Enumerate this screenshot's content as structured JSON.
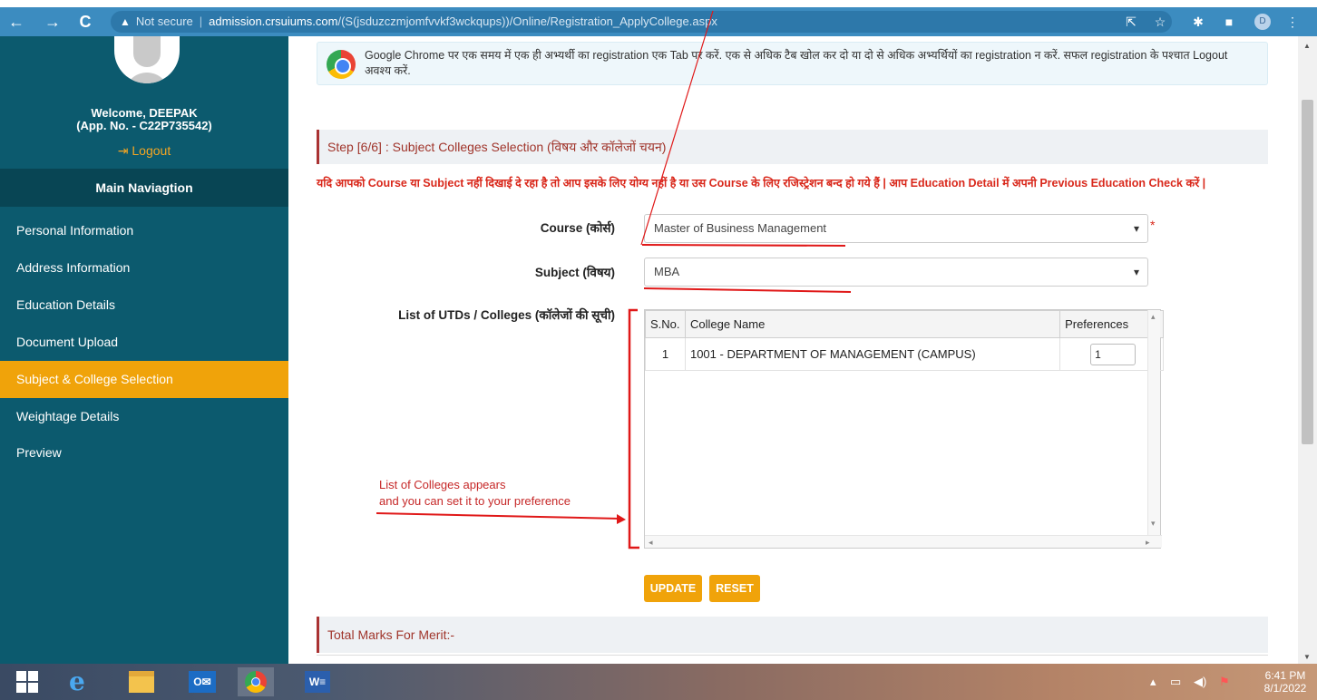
{
  "browser": {
    "nav": {
      "back": "←",
      "forward": "→",
      "reload": "C"
    },
    "url": {
      "warning_icon": "warning-icon",
      "security": "Not secure",
      "host": "admission.crsuiums.com",
      "path": "/(S(jsduzczmjomfvvkf3wckqups))/Online/Registration_ApplyCollege.aspx"
    },
    "profile_initial": "D",
    "icons": [
      "share-icon",
      "star-icon",
      "extensions-icon",
      "sidebar-icon",
      "profile-icon",
      "menu-icon"
    ]
  },
  "sidebar": {
    "welcome": "Welcome, DEEPAK",
    "app_no": "(App. No. - C22P735542)",
    "logout": "Logout",
    "nav_header": "Main Naviagtion",
    "items": [
      {
        "label": "Personal Information"
      },
      {
        "label": "Address Information"
      },
      {
        "label": "Education Details"
      },
      {
        "label": "Document Upload"
      },
      {
        "label": "Subject & College Selection",
        "active": true
      },
      {
        "label": "Weightage Details"
      },
      {
        "label": "Preview"
      }
    ]
  },
  "main": {
    "alert": "Google Chrome पर एक समय में एक ही अभ्यर्थी का registration एक Tab पर करें. एक से अधिक टैब खोल कर दो या दो से अधिक अभ्यर्थियों का registration न करें. सफल registration के पश्चात Logout अवश्य करें.",
    "step_prefix": "Step [6/6] :",
    "step_title": "Subject Colleges Selection (विषय और कॉलेजों चयन)",
    "warning": "यदि आपको Course या Subject नहीं दिखाई दे रहा है तो आप इसके लिए योग्य नहीं है या उस Course के लिए रजिस्ट्रेशन बन्द हो गये हैं | आप Education Detail में अपनी Previous Education Check करें |",
    "course_label": "Course (कोर्स)",
    "course_value": "Master of Business Management",
    "subject_label": "Subject (विषय)",
    "subject_value": "MBA",
    "colleges_label": "List of UTDs / Colleges (कॉलेजों की सूची)",
    "table": {
      "headers": [
        "S.No.",
        "College Name",
        "Preferences"
      ],
      "rows": [
        {
          "sno": "1",
          "name": "1001 - DEPARTMENT OF MANAGEMENT (CAMPUS)",
          "pref": "1"
        }
      ]
    },
    "update_button": "UPDATE",
    "reset_button": "RESET",
    "merit_title": "Total Marks For Merit:-"
  },
  "annotation": {
    "line1": "List of Colleges appears",
    "line2": "and you can set it to your preference"
  },
  "taskbar": {
    "apps": [
      "windows-start-icon",
      "internet-explorer-icon",
      "file-explorer-icon",
      "outlook-icon",
      "chrome-icon",
      "word-icon"
    ],
    "time": "6:41 PM",
    "date": "8/1/2022"
  },
  "colors": {
    "browser_bar": "#3c8cc0",
    "sidebar": "#0c5a6e",
    "active_nav": "#f0a30a",
    "accent_red": "#d9281b"
  }
}
